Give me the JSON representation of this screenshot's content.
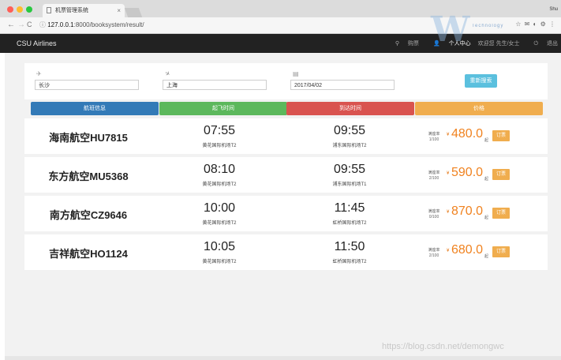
{
  "browser": {
    "tab_title": "机票管理系统",
    "tab_close": "×",
    "user_label": "Shu",
    "url_host": "127.0.0.1",
    "url_path": ":8000/booksystem/result/",
    "back_glyph": "←",
    "forward_glyph": "→",
    "reload_glyph": "C",
    "extensions": "☆ ✉ ◐ ⚙ ⋮"
  },
  "navbar": {
    "brand": "CSU Airlines",
    "items": [
      {
        "label": "购票",
        "icon": "search-icon"
      },
      {
        "label": "个人中心",
        "icon": "user-icon"
      },
      {
        "label": "欢迎您 先生/女士",
        "icon": ""
      },
      {
        "label": "退出",
        "icon": "power-icon"
      }
    ]
  },
  "watermark_top": {
    "logo": "W",
    "text": "Technology"
  },
  "search": {
    "from_icon": "plane-takeoff-icon",
    "from": "长沙",
    "to_icon": "plane-landing-icon",
    "to": "上海",
    "date_icon": "calendar-icon",
    "date": "2017/04/02",
    "button": "重新搜索"
  },
  "columns": [
    {
      "label": "航班信息",
      "color": "#337ab7"
    },
    {
      "label": "起飞时间",
      "color": "#5cb85c"
    },
    {
      "label": "到达时间",
      "color": "#d9534f"
    },
    {
      "label": "价格",
      "color": "#f0ad4e"
    }
  ],
  "flights": [
    {
      "airline": "海南航空HU7815",
      "dep_time": "07:55",
      "dep_airport": "黄花国际机场T2",
      "arr_time": "09:55",
      "arr_airport": "浦东国际机场T2",
      "rate_label": "满座率",
      "rate": "1/100",
      "currency": "¥",
      "price": "480.0",
      "price_suffix": "起",
      "book": "订票"
    },
    {
      "airline": "东方航空MU5368",
      "dep_time": "08:10",
      "dep_airport": "黄花国际机场T2",
      "arr_time": "09:55",
      "arr_airport": "浦东国际机场T1",
      "rate_label": "满座率",
      "rate": "2/100",
      "currency": "¥",
      "price": "590.0",
      "price_suffix": "起",
      "book": "订票"
    },
    {
      "airline": "南方航空CZ9646",
      "dep_time": "10:00",
      "dep_airport": "黄花国际机场T2",
      "arr_time": "11:45",
      "arr_airport": "虹桥国际机场T2",
      "rate_label": "满座率",
      "rate": "0/100",
      "currency": "¥",
      "price": "870.0",
      "price_suffix": "起",
      "book": "订票"
    },
    {
      "airline": "吉祥航空HO1124",
      "dep_time": "10:05",
      "dep_airport": "黄花国际机场T2",
      "arr_time": "11:50",
      "arr_airport": "虹桥国际机场T2",
      "rate_label": "满座率",
      "rate": "2/100",
      "currency": "¥",
      "price": "680.0",
      "price_suffix": "起",
      "book": "订票"
    }
  ],
  "watermark": "https://blog.csdn.net/demongwc"
}
